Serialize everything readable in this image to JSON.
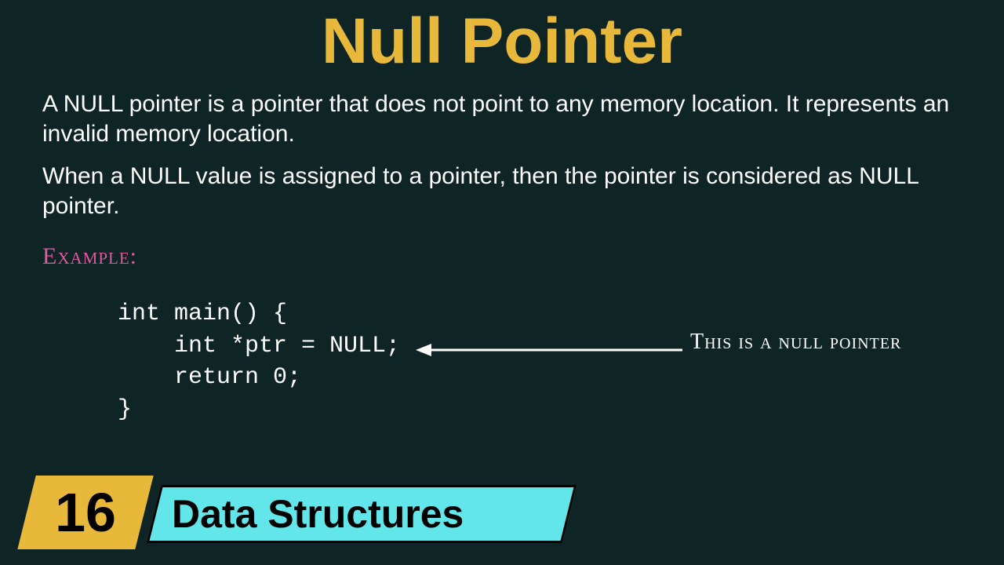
{
  "title": "Null Pointer",
  "paragraph1": "A NULL pointer is a pointer that does not point to any memory location. It represents an invalid memory location.",
  "paragraph2": "When a NULL value is assigned to a pointer, then the pointer is considered as NULL pointer.",
  "exampleLabel": "Example:",
  "code": "int main() {\n    int *ptr = NULL;\n    return 0;\n}",
  "callout": "This is a null pointer",
  "badge": {
    "number": "16",
    "topic": "Data Structures"
  },
  "colors": {
    "background": "#0f2424",
    "title": "#e8b83b",
    "accent": "#e05aa0",
    "badgeNumber": "#e8b83b",
    "badgeTopic": "#62e6ea"
  }
}
